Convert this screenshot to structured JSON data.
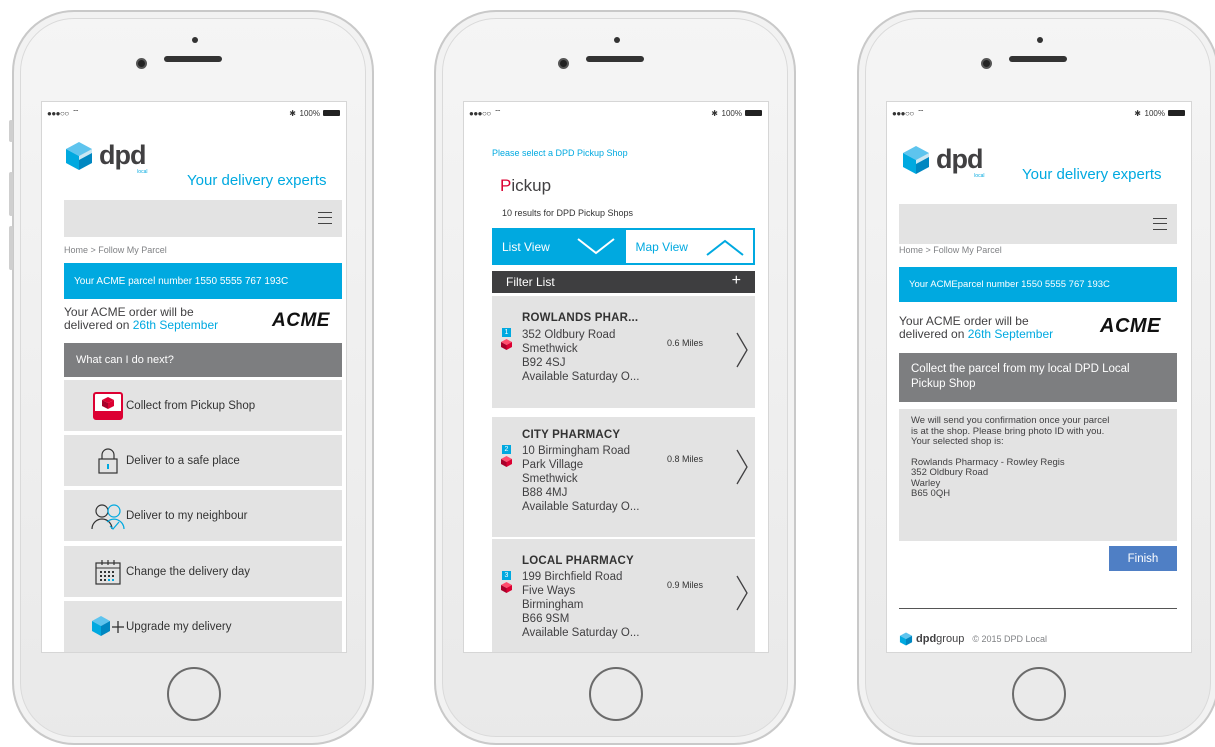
{
  "status": {
    "signal": "●●●○○",
    "bluetooth": "✱",
    "battery": "100%"
  },
  "brand": {
    "word": "dpd",
    "local": "local",
    "tagline": "Your delivery experts"
  },
  "screen1": {
    "breadcrumb": "Home > Follow My Parcel",
    "parcel_banner": "Your ACME parcel number 1550 5555 767 193C",
    "order_line1": "Your ACME order will be",
    "order_line2": "delivered on ",
    "order_date": "26th September",
    "retailer": "ACME",
    "next_heading": "What can I do next?",
    "options": [
      {
        "label": "Collect from Pickup Shop",
        "icon": "pickup-shop-icon"
      },
      {
        "label": "Deliver to a safe place",
        "icon": "padlock-icon"
      },
      {
        "label": "Deliver to my neighbour",
        "icon": "neighbour-icon"
      },
      {
        "label": "Change the delivery day",
        "icon": "calendar-icon"
      },
      {
        "label": "Upgrade my delivery",
        "icon": "upgrade-icon"
      }
    ]
  },
  "screen2": {
    "select_prompt": "Please select a DPD Pickup Shop",
    "title_initial": "P",
    "title_rest": "ickup",
    "results": "10 results for DPD Pickup Shops",
    "tab_list": "List View",
    "tab_map": "Map View",
    "filter": "Filter List",
    "filter_plus": "+",
    "shops": [
      {
        "num": "1",
        "name": "ROWLANDS PHAR...",
        "lines": [
          "352 Oldbury Road",
          "Smethwick",
          "B92 4SJ",
          "Available Saturday O..."
        ],
        "distance": "0.6 Miles"
      },
      {
        "num": "2",
        "name": "CITY PHARMACY",
        "lines": [
          "10 Birmingham Road",
          "Park Village",
          "Smethwick",
          "B88 4MJ",
          "Available Saturday O..."
        ],
        "distance": "0.8 Miles"
      },
      {
        "num": "3",
        "name": "LOCAL PHARMACY",
        "lines": [
          "199 Birchfield Road",
          "Five Ways",
          "Birmingham",
          "B66 9SM",
          "Available Saturday O..."
        ],
        "distance": "0.9 Miles"
      }
    ]
  },
  "screen3": {
    "breadcrumb": "Home > Follow My Parcel",
    "parcel_banner": "Your ACMEparcel number 1550 5555 767 193C",
    "order_line1": "Your ACME order will be",
    "order_line2": "delivered on ",
    "order_date": "26th September",
    "retailer": "ACME",
    "collect_heading": "Collect the parcel from my local DPD Local Pickup Shop",
    "confirm_lines": [
      "We will send you confirmation once your parcel",
      "is at the shop. Please bring photo ID with you.",
      "Your selected shop is:"
    ],
    "shop_lines": [
      "Rowlands Pharmacy - Rowley Regis",
      "352 Oldbury Road",
      "Warley",
      "B65 0QH"
    ],
    "finish": "Finish",
    "footer_brand_bold": "dpd",
    "footer_brand_rest": "group",
    "copyright": "© 2015 DPD Local"
  },
  "colors": {
    "dpd_blue": "#00a9e0",
    "dpd_red": "#dc0032",
    "grey_bar": "#7d7e80",
    "light_grey": "#e3e3e3",
    "finish_blue": "#4f7fc5"
  }
}
